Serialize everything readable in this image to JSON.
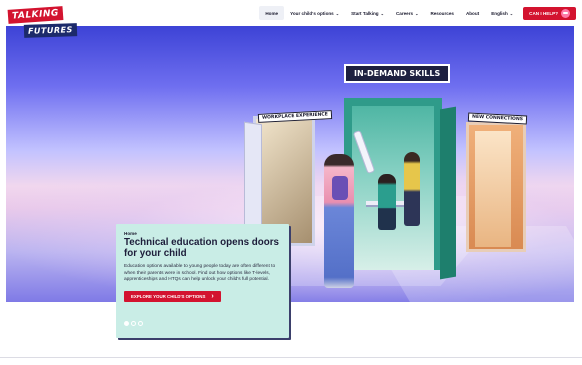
{
  "logo": {
    "line1": "TALKING",
    "line2": "FUTURES"
  },
  "nav": {
    "items": [
      {
        "label": "Home",
        "active": true,
        "dropdown": false
      },
      {
        "label": "Your child's options",
        "active": false,
        "dropdown": true
      },
      {
        "label": "Start Talking",
        "active": false,
        "dropdown": true
      },
      {
        "label": "Careers",
        "active": false,
        "dropdown": true
      },
      {
        "label": "Resources",
        "active": false,
        "dropdown": false
      },
      {
        "label": "About",
        "active": false,
        "dropdown": false
      },
      {
        "label": "English",
        "active": false,
        "dropdown": true
      }
    ],
    "help_button": "CAN I HELP?"
  },
  "hero": {
    "signs": {
      "left": "WORKPLACE EXPERIENCE",
      "middle": "IN-DEMAND SKILLS",
      "right": "NEW CONNECTIONS"
    }
  },
  "card": {
    "breadcrumb": "Home",
    "title": "Technical education opens doors for your child",
    "body": "Education options available to young people today are often different to when their parents were in school. Find out how options like T-levels, apprenticeships and HTQs can help unlock your child's full potential.",
    "cta_label": "EXPLORE YOUR CHILD'S OPTIONS",
    "slides": {
      "count": 3,
      "active_index": 0
    }
  },
  "colors": {
    "brand_red": "#d3132f",
    "card_bg": "#c9ede6",
    "door_teal": "#2f9b8a",
    "navy": "#1c2a6b"
  }
}
